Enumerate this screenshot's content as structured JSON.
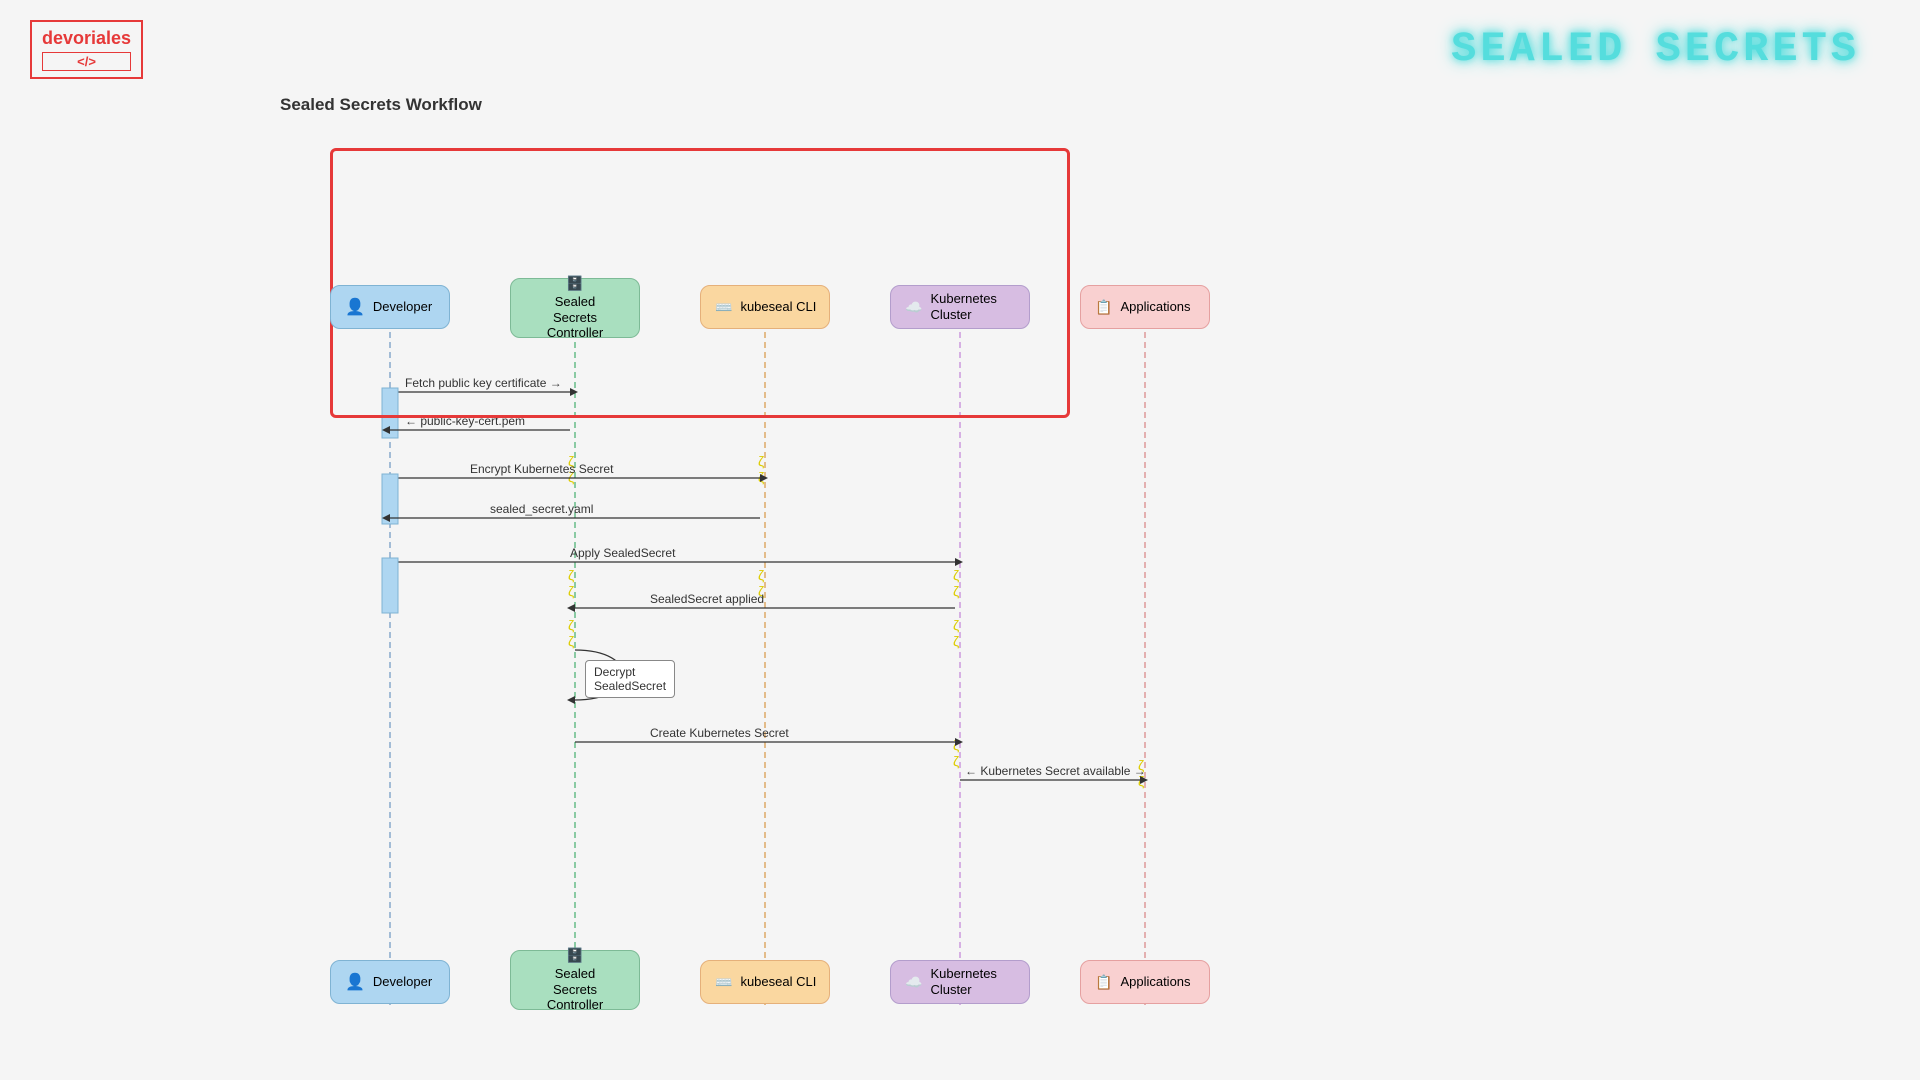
{
  "logo": {
    "name": "devoriales",
    "sub": "</>"
  },
  "header_title": "SEALED SECRETS",
  "page_subtitle": "Sealed Secrets Workflow",
  "actors": {
    "developer": "Developer",
    "ssc_line1": "Sealed",
    "ssc_line2": "Secrets",
    "ssc_line3": "Controller",
    "kubeseal": "kubeseal CLI",
    "kubernetes": "Kubernetes\nCluster",
    "k8s_line1": "Kubernetes",
    "k8s_line2": "Cluster",
    "applications": "Applications"
  },
  "messages": {
    "fetch_public_key": "Fetch public key certificate →",
    "public_key_cert": "← public-key-cert.pem",
    "encrypt_k8s": "Encrypt Kubernetes Secret",
    "sealed_secret_yaml": "sealed_secret.yaml",
    "apply_sealed_secret": "Apply SealedSecret",
    "sealed_secret_applied": "SealedSecret applied",
    "decrypt_label": "Decrypt\nSealedSecret",
    "create_k8s_secret": "Create Kubernetes Secret",
    "k8s_secret_available": "← Kubernetes Secret available →"
  }
}
